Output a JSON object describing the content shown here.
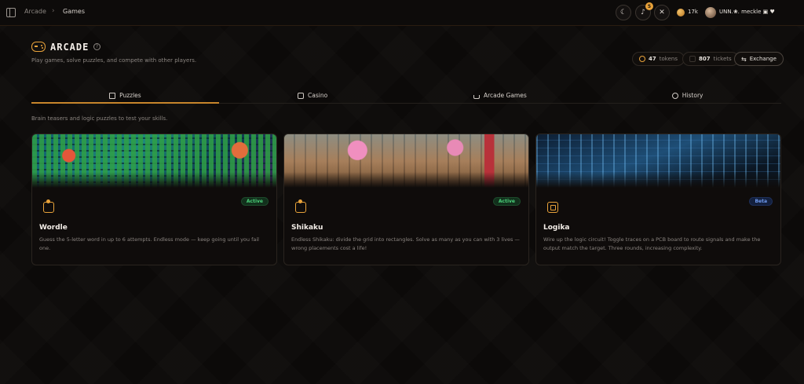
{
  "topbar": {
    "breadcrumb": [
      "Arcade",
      "Games"
    ],
    "notifications_count": "5",
    "coins": "17k",
    "username": "UNN.❀. meckle ▣ ♥"
  },
  "header": {
    "title": "ARCADE",
    "subtitle": "Play games, solve puzzles, and compete with other players.",
    "tokens_value": "47",
    "tokens_label": "tokens",
    "tickets_value": "807",
    "tickets_label": "tickets",
    "exchange_label": "Exchange"
  },
  "tabs": [
    {
      "label": "Puzzles",
      "active": true
    },
    {
      "label": "Casino",
      "active": false
    },
    {
      "label": "Arcade Games",
      "active": false
    },
    {
      "label": "History",
      "active": false
    }
  ],
  "section_description": "Brain teasers and logic puzzles to test your skills.",
  "cards": [
    {
      "title": "Wordle",
      "status": "Active",
      "description": "Guess the 5-letter word in up to 6 attempts. Endless mode — keep going until you fail one."
    },
    {
      "title": "Shikaku",
      "status": "Active",
      "description": "Endless Shikaku: divide the grid into rectangles. Solve as many as you can with 3 lives — wrong placements cost a life!"
    },
    {
      "title": "Logika",
      "status": "Beta",
      "description": "Wire up the logic circuit! Toggle traces on a PCB board to route signals and make the output match the target. Three rounds, increasing complexity."
    }
  ],
  "colors": {
    "accent": "#e8a23a",
    "active_badge": "#4bd17a",
    "beta_badge": "#6f9bf0"
  }
}
